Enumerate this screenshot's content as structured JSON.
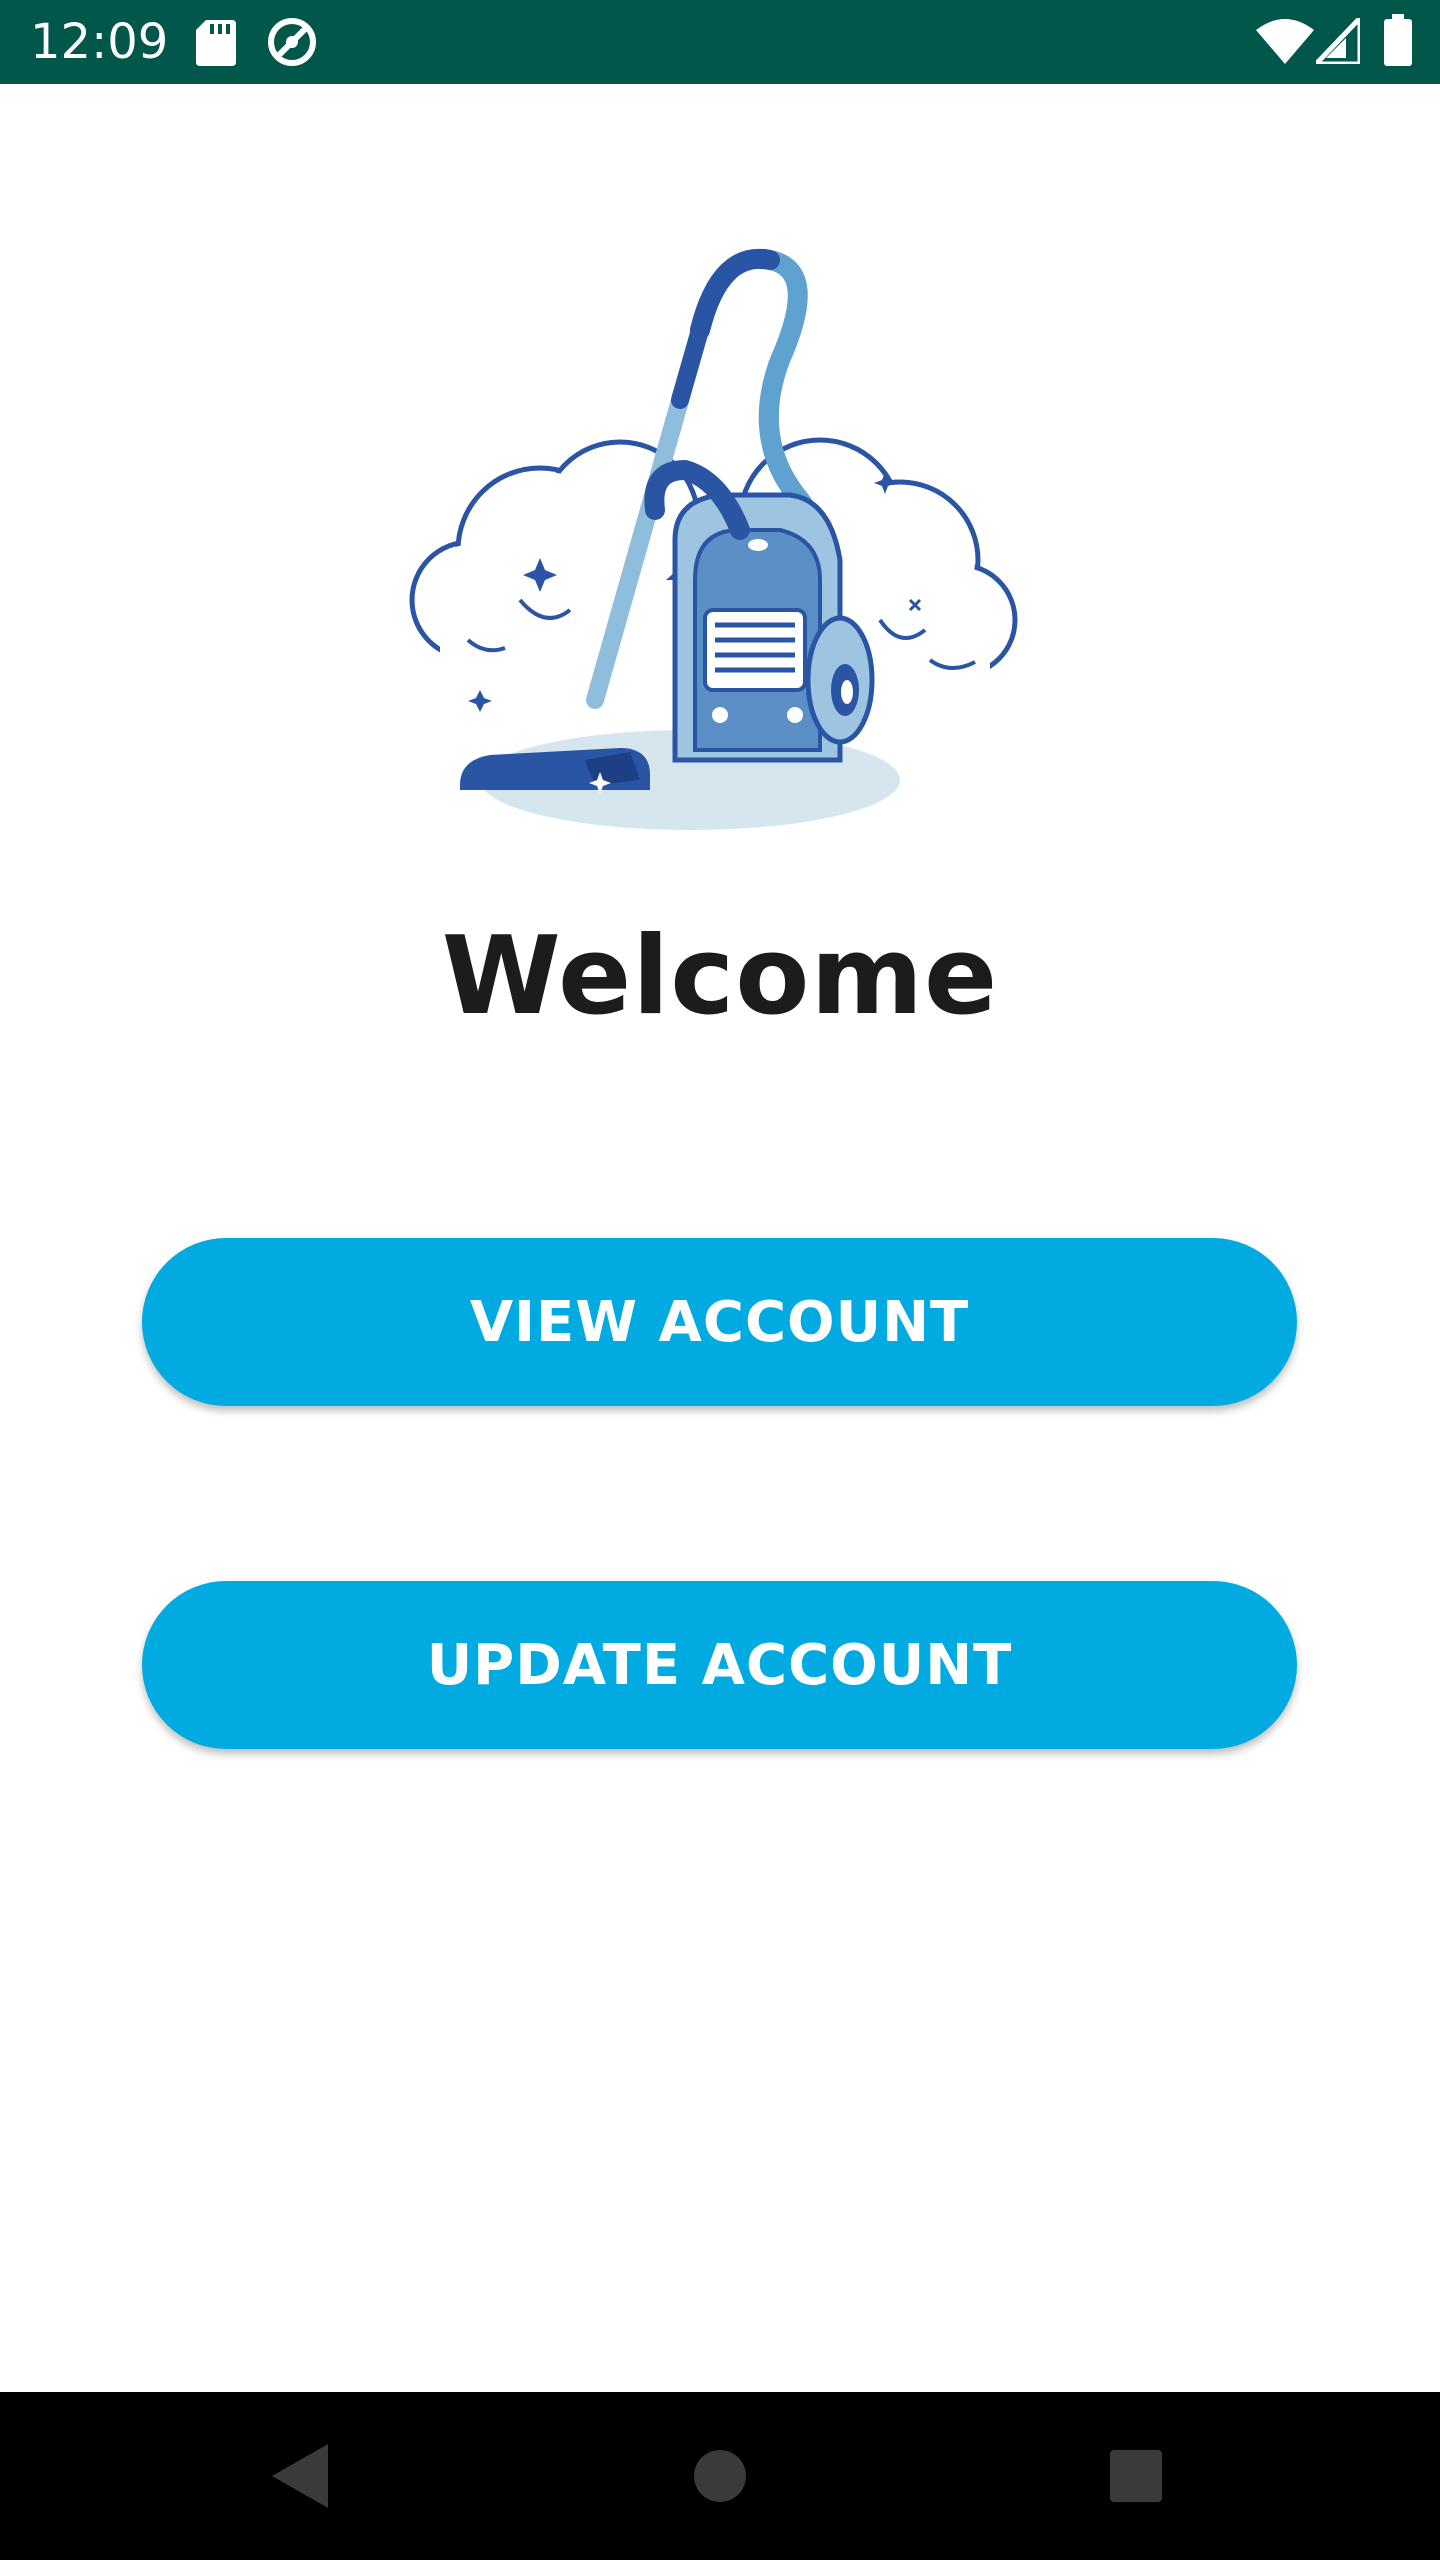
{
  "status_bar": {
    "time": "12:09",
    "left_icons": [
      "sd-card-icon",
      "sync-blocked-icon"
    ],
    "right_icons": [
      "wifi-icon",
      "cellular-signal-icon",
      "battery-icon"
    ],
    "background_color": "#00574a"
  },
  "main": {
    "logo_icon": "vacuum-cleaner-logo",
    "welcome_text": "Welcome",
    "buttons": {
      "view_account": "VIEW ACCOUNT",
      "update_account": "UPDATE ACCOUNT"
    },
    "button_color": "#01aae0"
  },
  "nav_bar": {
    "icons": [
      "back-icon",
      "home-icon",
      "recents-icon"
    ]
  }
}
